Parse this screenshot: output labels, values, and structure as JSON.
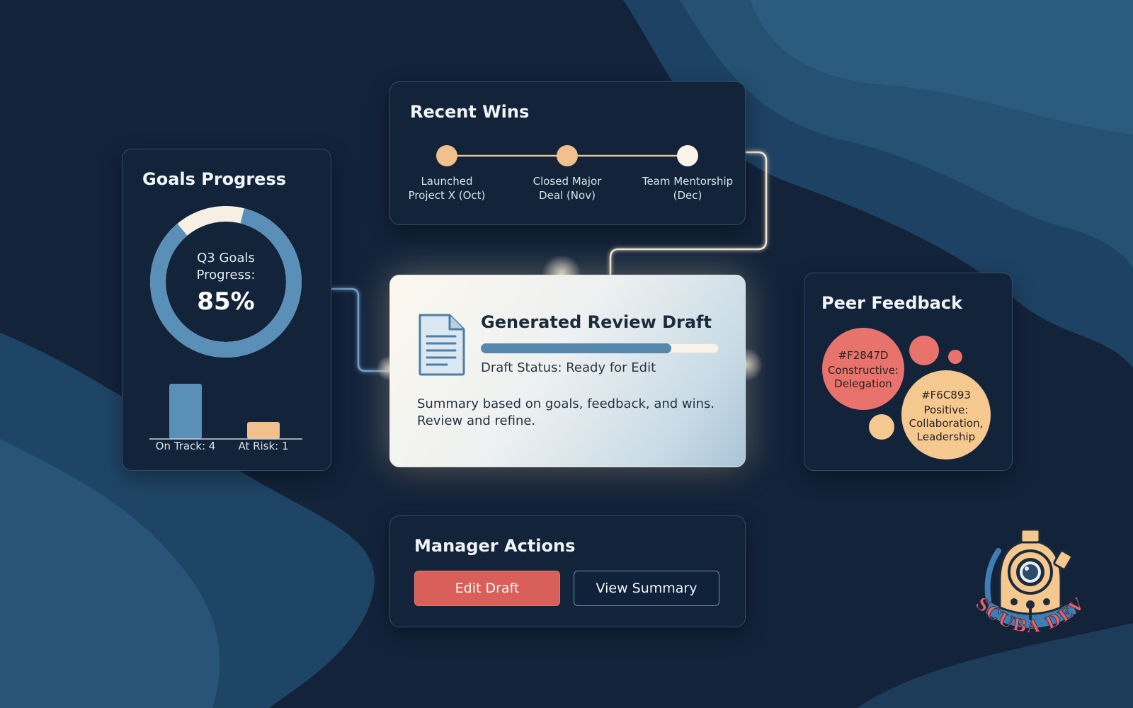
{
  "goals": {
    "title": "Goals Progress",
    "ring_label": "Q3 Goals\nProgress:",
    "ring_value": "85%",
    "progress_fraction": 0.85,
    "bars": [
      {
        "label": "On Track: 4",
        "value": 4,
        "color": "#5a8fb8"
      },
      {
        "label": "At Risk: 1",
        "value": 1,
        "color": "#f2c08c"
      }
    ]
  },
  "wins": {
    "title": "Recent Wins",
    "milestones": [
      {
        "label": "Launched\nProject X (Oct)",
        "color": "#f2c08c"
      },
      {
        "label": "Closed Major\nDeal (Nov)",
        "color": "#f2c08c"
      },
      {
        "label": "Team Mentorship\n(Dec)",
        "color": "#fbf4ea"
      }
    ]
  },
  "draft": {
    "title": "Generated Review Draft",
    "status": "Draft Status: Ready for Edit",
    "progress_fraction": 0.8,
    "summary": "Summary based on goals, feedback, and wins.\nReview and refine."
  },
  "peer": {
    "title": "Peer Feedback",
    "constructive": {
      "code": "#F2847D",
      "text": "Constructive:\nDelegation",
      "color": "#e8736c"
    },
    "positive": {
      "code": "#F6C893",
      "text": "Positive:\nCollaboration,\nLeadership",
      "color": "#f5c88f"
    }
  },
  "actions": {
    "title": "Manager Actions",
    "edit_label": "Edit Draft",
    "view_label": "View Summary"
  },
  "logo": {
    "text": "SCUBA DEV",
    "icon": "diving-helmet-icon"
  },
  "colors": {
    "background": "#142436",
    "card": "#12233a",
    "accent_blue": "#5687ad",
    "accent_red": "#d9605a",
    "accent_peach": "#f2c08c"
  }
}
